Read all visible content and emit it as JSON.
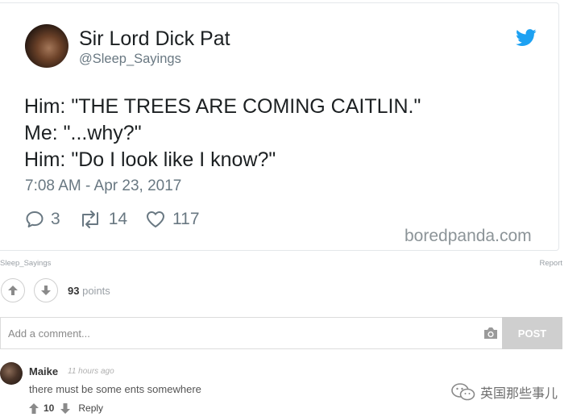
{
  "tweet": {
    "name": "Sir Lord Dick Pat",
    "handle": "@Sleep_Sayings",
    "lines": [
      "Him: \"THE TREES ARE COMING CAITLIN.\"",
      "Me: \"...why?\"",
      "Him: \"Do I look like I know?\""
    ],
    "timestamp": "7:08 AM - Apr 23, 2017",
    "replies": "3",
    "retweets": "14",
    "likes": "117",
    "watermark": "boredpanda.com",
    "brand_color": "#1da1f2"
  },
  "post_meta": {
    "source": "Sleep_Sayings",
    "report": "Report"
  },
  "votes": {
    "count": "93",
    "unit": "points"
  },
  "comment_form": {
    "placeholder": "Add a comment...",
    "post_label": "POST"
  },
  "comment": {
    "author": "Maike",
    "time": "11 hours ago",
    "text": "there must be some ents somewhere",
    "votes": "10",
    "reply_label": "Reply"
  },
  "overlay": {
    "wechat_label": "英国那些事儿"
  }
}
